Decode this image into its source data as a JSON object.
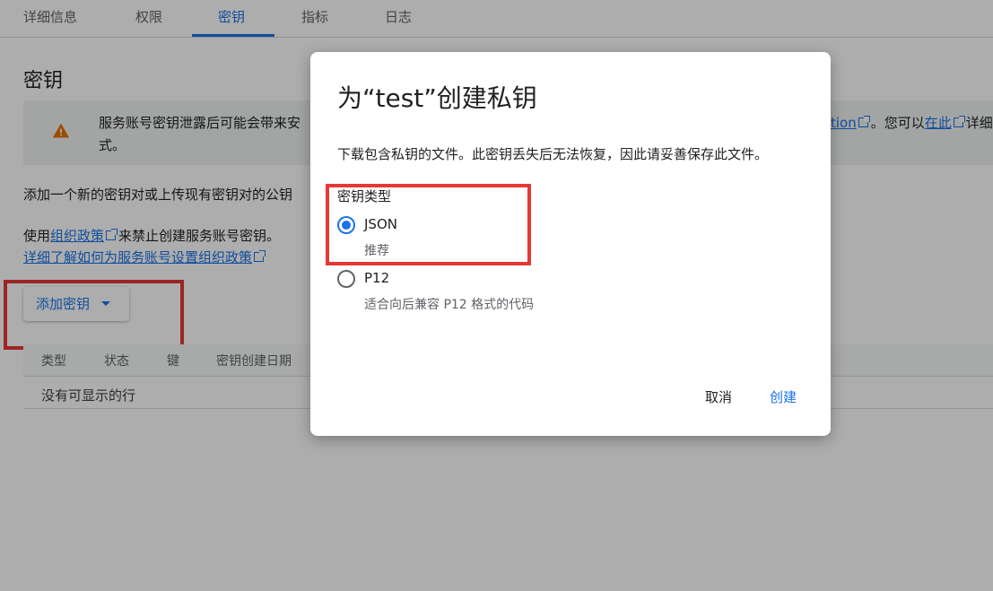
{
  "tabs": [
    "详细信息",
    "权限",
    "密钥",
    "指标",
    "日志"
  ],
  "section_title": "密钥",
  "warning": {
    "text": "服务账号密钥泄露后可能会带来安全风险。我们建议您不要下载服务账号密钥，而是改用 Workload Identity Federation 或其他方式。",
    "visible_text": "服务账号密钥泄露后可能会带来安",
    "text_line2": "式。",
    "link_visible": "tion",
    "tail": "。您可以",
    "link2": "在此",
    "tail2": "详细"
  },
  "description": "添加一个新的密钥对或上传现有密钥对的公钥。",
  "description_visible": "添加一个新的密钥对或上传现有密钥对的公钥",
  "policy": {
    "prefix": "使用",
    "link": "组织政策",
    "suffix": "来禁止创建服务账号密钥。",
    "learn_more": "详细了解如何为服务账号设置组织政策"
  },
  "add_key_button": "添加密钥",
  "table": {
    "columns": [
      "类型",
      "状态",
      "键",
      "密钥创建日期"
    ],
    "empty": "没有可显示的行"
  },
  "dialog": {
    "title": "为“test”创建私钥",
    "description": "下载包含私钥的文件。此密钥丢失后无法恢复，因此请妥善保存此文件。",
    "key_type_label": "密钥类型",
    "options": [
      {
        "label": "JSON",
        "sub": "推荐",
        "checked": true
      },
      {
        "label": "P12",
        "sub": "适合向后兼容 P12 格式的代码",
        "checked": false
      }
    ],
    "cancel": "取消",
    "create": "创建"
  },
  "colors": {
    "accent": "#1a73e8",
    "warning": "#e37400",
    "annotation": "#e53935"
  }
}
